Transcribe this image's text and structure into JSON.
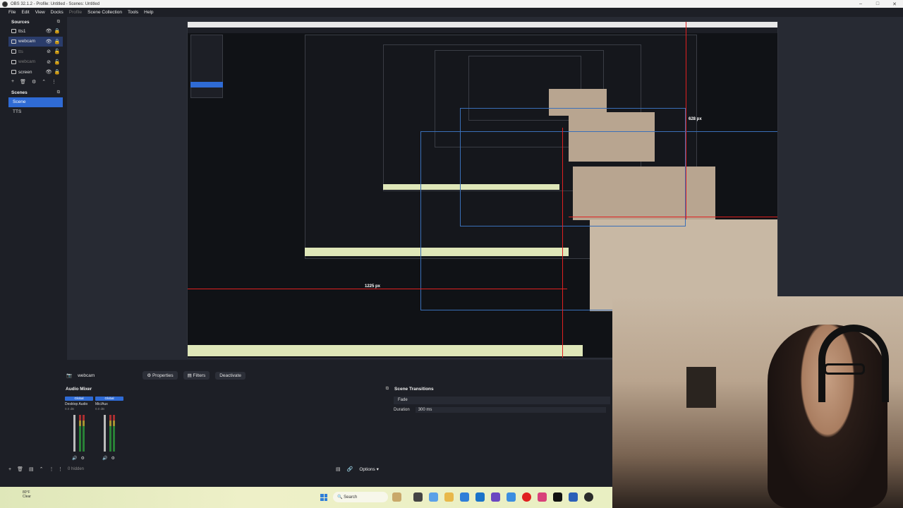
{
  "window": {
    "title": "OBS 32.1.2 - Profile: Untitled - Scenes: Untitled",
    "controls": {
      "minimize": "–",
      "maximize": "□",
      "close": "✕"
    }
  },
  "menu": {
    "items": [
      "File",
      "Edit",
      "View",
      "Docks",
      "Profile",
      "Scene Collection",
      "Tools",
      "Help"
    ]
  },
  "sources": {
    "title": "Sources",
    "items": [
      {
        "name": "tts1",
        "visible": true,
        "locked": true,
        "selected": false,
        "dim": false
      },
      {
        "name": "webcam",
        "visible": true,
        "locked": true,
        "selected": true,
        "dim": false
      },
      {
        "name": "tts",
        "visible": false,
        "locked": false,
        "selected": false,
        "dim": true
      },
      {
        "name": "webcam",
        "visible": false,
        "locked": false,
        "selected": false,
        "dim": true
      },
      {
        "name": "screen",
        "visible": true,
        "locked": true,
        "selected": false,
        "dim": false
      }
    ]
  },
  "scenes": {
    "title": "Scenes",
    "items": [
      {
        "name": "Scene",
        "selected": true
      },
      {
        "name": "TTS",
        "selected": false
      }
    ]
  },
  "preview": {
    "measure_h": "628 px",
    "measure_w": "1225 px"
  },
  "controls_bar": {
    "source_name": "webcam",
    "properties_label": "Properties",
    "filters_label": "Filters",
    "deactivate_label": "Deactivate"
  },
  "audio_mixer": {
    "title": "Audio Mixer",
    "channels": [
      {
        "scope": "Global",
        "name": "Desktop Audio",
        "db": "0.0 dB"
      },
      {
        "scope": "Global",
        "name": "Mic/Aux",
        "db": "0.0 dB"
      }
    ]
  },
  "scene_transitions": {
    "title": "Scene Transitions",
    "transition": "Fade",
    "duration_label": "Duration",
    "duration_value": "300 ms"
  },
  "bottom_bar": {
    "hidden_count": "0 hidden",
    "options_label": "Options"
  },
  "taskbar": {
    "weather_temp": "80°F",
    "weather_desc": "Clear",
    "search_label": "Search"
  }
}
